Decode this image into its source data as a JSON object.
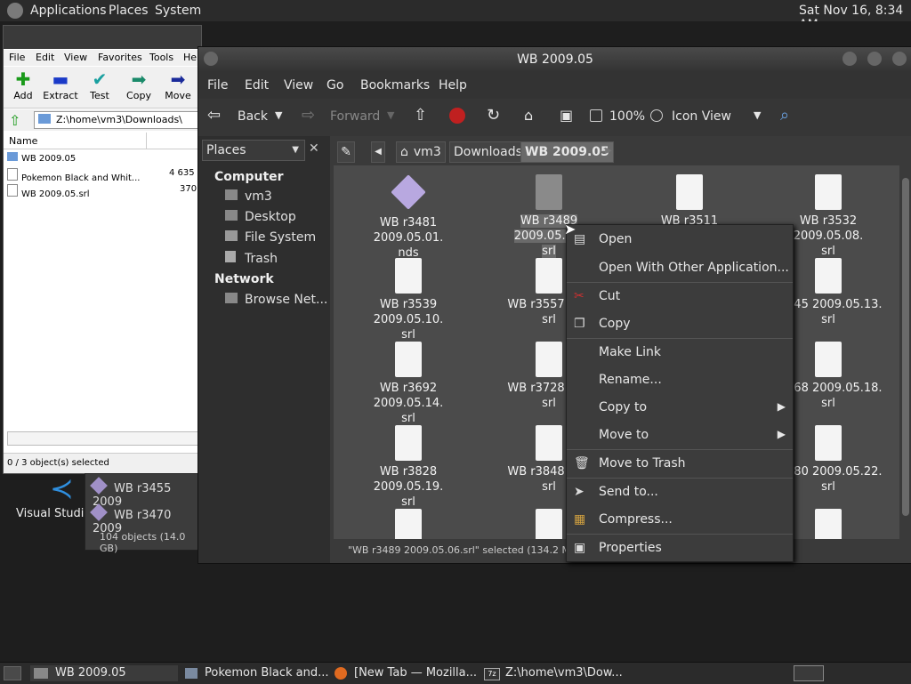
{
  "top_panel": {
    "menus": [
      "Applications",
      "Places",
      "System"
    ],
    "clock": "Sat Nov 16,  8:34 AM"
  },
  "zip_window": {
    "title": "Z:\\home\\vm3\\Downloads\\",
    "menu": [
      "File",
      "Edit",
      "View",
      "Favorites",
      "Tools",
      "He"
    ],
    "toolbar": [
      {
        "label": "Add",
        "icon": "plus-icon"
      },
      {
        "label": "Extract",
        "icon": "minus-icon"
      },
      {
        "label": "Test",
        "icon": "check-icon"
      },
      {
        "label": "Copy",
        "icon": "arrow-right-icon"
      },
      {
        "label": "Move",
        "icon": "arrow-right-icon"
      }
    ],
    "address": "Z:\\home\\vm3\\Downloads\\",
    "column_name": "Name",
    "rows": [
      {
        "name": "WB 2009.05",
        "size": ""
      },
      {
        "name": "Pokemon Black and Whit...",
        "size": "4 635"
      },
      {
        "name": "WB 2009.05.srl",
        "size": "370"
      }
    ],
    "status": "0 / 3 object(s) selected"
  },
  "desktop": {
    "vscode_label": "Visual Studio"
  },
  "popup": {
    "items": [
      "WB r3455 2009",
      "WB r3470 2009"
    ],
    "status": "104 objects (14.0 GB)"
  },
  "file_manager": {
    "title": "WB 2009.05",
    "menu": [
      "File",
      "Edit",
      "View",
      "Go",
      "Bookmarks",
      "Help"
    ],
    "toolbar": {
      "back": "Back",
      "forward": "Forward",
      "zoom": "100%",
      "view_mode": "Icon View"
    },
    "places_header": "Places",
    "sidebar": {
      "computer": "Computer",
      "computer_items": [
        "vm3",
        "Desktop",
        "File System",
        "Trash"
      ],
      "network": "Network",
      "network_items": [
        "Browse Net..."
      ]
    },
    "path": [
      "vm3",
      "Downloads",
      "WB 2009.05"
    ],
    "files": [
      {
        "line1": "WB r3481 2009.05.01.",
        "line2": "nds"
      },
      {
        "line1": "WB r3489 2009.05.06.",
        "line2": "srl"
      },
      {
        "line1": "WB r3511 2009.05.07.",
        "line2": ""
      },
      {
        "line1": "WB r3532 2009.05.08.",
        "line2": "srl"
      },
      {
        "line1": "WB r3539 2009.05.10.",
        "line2": "srl"
      },
      {
        "line1": "WB r3557 200",
        "line2": "srl"
      },
      {
        "line1": "",
        "line2": ""
      },
      {
        "line1": "r3645 2009.05.13.",
        "line2": "srl"
      },
      {
        "line1": "WB r3692 2009.05.14.",
        "line2": "srl"
      },
      {
        "line1": "WB r3728 200",
        "line2": "srl"
      },
      {
        "line1": "",
        "line2": ""
      },
      {
        "line1": "r3768 2009.05.18.",
        "line2": "srl"
      },
      {
        "line1": "WB r3828 2009.05.19.",
        "line2": "srl"
      },
      {
        "line1": "WB r3848 200",
        "line2": "srl"
      },
      {
        "line1": "",
        "line2": ""
      },
      {
        "line1": "r3980 2009.05.22.",
        "line2": "srl"
      }
    ],
    "status": "\"WB r3489 2009.05.06.srl\" selected (134.2 MB), Fr"
  },
  "context_menu": [
    {
      "label": "Open",
      "icon": "open-icon"
    },
    {
      "label": "Open With Other Application...",
      "icon": ""
    },
    {
      "label": "Cut",
      "icon": "scissors-icon"
    },
    {
      "label": "Copy",
      "icon": "copy-icon"
    },
    {
      "label": "Make Link",
      "icon": ""
    },
    {
      "label": "Rename...",
      "icon": ""
    },
    {
      "label": "Copy to",
      "icon": "",
      "submenu": true
    },
    {
      "label": "Move to",
      "icon": "",
      "submenu": true
    },
    {
      "label": "Move to Trash",
      "icon": "trash-icon"
    },
    {
      "label": "Send to...",
      "icon": "send-icon"
    },
    {
      "label": "Compress...",
      "icon": "archive-icon"
    },
    {
      "label": "Properties",
      "icon": "properties-icon"
    }
  ],
  "taskbar": [
    {
      "label": "WB 2009.05"
    },
    {
      "label": "Pokemon Black and..."
    },
    {
      "label": "[New Tab — Mozilla..."
    },
    {
      "label": "Z:\\home\\vm3\\Dow..."
    }
  ]
}
